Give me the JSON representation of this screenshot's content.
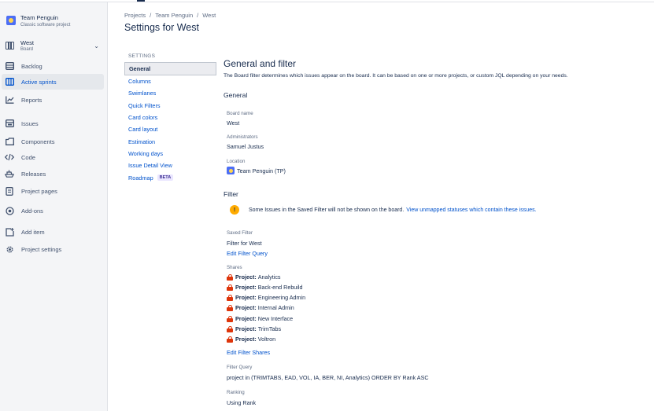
{
  "project": {
    "name": "Team Penguin",
    "type": "Classic software project"
  },
  "board": {
    "name": "West",
    "type": "Board"
  },
  "sidebar": {
    "items": [
      {
        "label": "Backlog",
        "icon": "backlog-icon"
      },
      {
        "label": "Active sprints",
        "icon": "board-icon",
        "active": true
      },
      {
        "label": "Reports",
        "icon": "chart-icon"
      },
      {
        "label": "Issues",
        "icon": "issues-icon"
      },
      {
        "label": "Components",
        "icon": "components-icon"
      },
      {
        "label": "Code",
        "icon": "code-icon"
      },
      {
        "label": "Releases",
        "icon": "ship-icon"
      },
      {
        "label": "Project pages",
        "icon": "page-icon"
      },
      {
        "label": "Add-ons",
        "icon": "addons-icon"
      },
      {
        "label": "Add item",
        "icon": "add-item-icon"
      },
      {
        "label": "Project settings",
        "icon": "gear-icon"
      }
    ]
  },
  "breadcrumb": [
    "Projects",
    "Team Penguin",
    "West"
  ],
  "page_title": "Settings for West",
  "settings_nav": {
    "heading": "SETTINGS",
    "items": [
      "General",
      "Columns",
      "Swimlanes",
      "Quick Filters",
      "Card colors",
      "Card layout",
      "Estimation",
      "Working days",
      "Issue Detail View",
      "Roadmap"
    ],
    "beta_label": "BETA"
  },
  "content": {
    "title": "General and filter",
    "description": "The Board filter determines which issues appear on the board. It can be based on one or more projects, or custom JQL depending on your needs.",
    "general_heading": "General",
    "board_name_label": "Board name",
    "board_name_value": "West",
    "admins_label": "Administrators",
    "admins_value": "Samuel Justus",
    "location_label": "Location",
    "location_value": "Team Penguin (TP)",
    "filter_heading": "Filter",
    "warning_text": "Some Issues in the Saved Filter will not be shown on the board.",
    "warning_link": "View unmapped statuses which contain these issues.",
    "saved_filter_label": "Saved Filter",
    "saved_filter_value": "Filter for West",
    "edit_filter_query": "Edit Filter Query",
    "shares_label": "Shares",
    "share_prefix": "Project:",
    "shares": [
      "Analytics",
      "Back-end Rebuild",
      "Engineering Admin",
      "Internal Admin",
      "New Interface",
      "TrimTabs",
      "Voltron"
    ],
    "edit_filter_shares": "Edit Filter Shares",
    "filter_query_label": "Filter Query",
    "filter_query_value": "project in (TRIMTABS, EAD, VOL, IA, BER, NI, Analytics) ORDER BY Rank ASC",
    "ranking_label": "Ranking",
    "ranking_value": "Using Rank"
  },
  "colors": {
    "link": "#0052cc",
    "lock": "#de350b",
    "warning": "#ffab00"
  }
}
